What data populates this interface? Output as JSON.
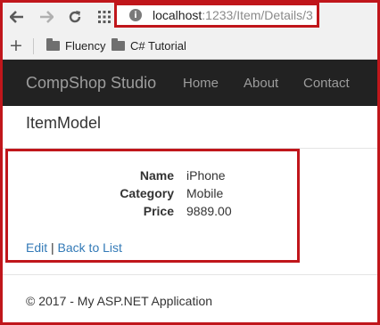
{
  "browser": {
    "url_host": "localhost",
    "url_path": ":1233/Item/Details/3",
    "bookmarks": [
      "Fluency",
      "C# Tutorial"
    ],
    "colors": {
      "highlight": "#c0161b"
    }
  },
  "site": {
    "brand": "CompShop Studio",
    "nav": [
      "Home",
      "About",
      "Contact"
    ]
  },
  "page": {
    "heading": "ItemModel",
    "fields": [
      {
        "label": "Name",
        "value": "iPhone"
      },
      {
        "label": "Category",
        "value": "Mobile"
      },
      {
        "label": "Price",
        "value": "9889.00"
      }
    ],
    "edit_link": "Edit",
    "separator": "|",
    "back_link": "Back to List",
    "footer": "© 2017 - My ASP.NET Application"
  }
}
